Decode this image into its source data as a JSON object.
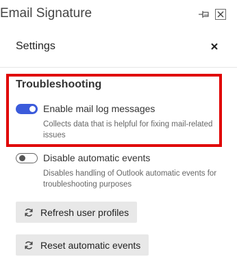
{
  "pane": {
    "title": "Email Signature",
    "pin_icon": "pin-icon",
    "close_icon": "close-icon"
  },
  "settings": {
    "title": "Settings",
    "close_icon": "close-icon"
  },
  "troubleshooting": {
    "title": "Troubleshooting",
    "highlight_color": "#e00000",
    "options": [
      {
        "label": "Enable mail log messages",
        "description": "Collects data that is helpful for fixing mail-related issues",
        "enabled": true
      },
      {
        "label": "Disable automatic events",
        "description": "Disables handling of Outlook automatic events for troubleshooting purposes",
        "enabled": false
      }
    ]
  },
  "buttons": {
    "refresh_label": "Refresh user profiles",
    "reset_label": "Reset automatic events",
    "icon": "refresh-icon"
  },
  "colors": {
    "toggle_on": "#3b5bdb",
    "button_bg": "#e8e8e8"
  }
}
